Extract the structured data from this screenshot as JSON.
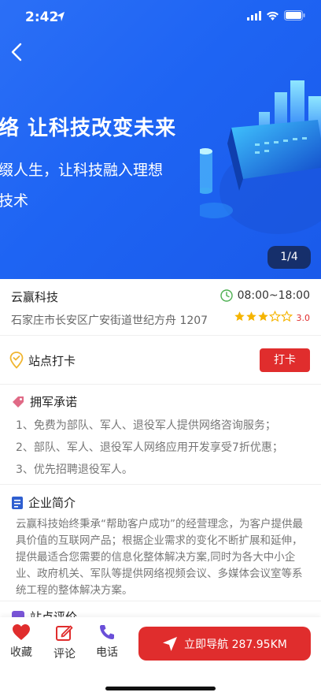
{
  "status_bar": {
    "time": "2:42"
  },
  "hero": {
    "line1": "络  让科技改变未来",
    "line2": "缀人生，让科技融入理想",
    "line3": "技术",
    "page_indicator": "1/4"
  },
  "info": {
    "company_name": "云赢科技",
    "hours": "08:00~18:00",
    "address": "石家庄市长安区广安街道世纪方舟 1207",
    "rating_value": "3.0",
    "rating_stars": 3
  },
  "checkin": {
    "label": "站点打卡",
    "button": "打卡"
  },
  "promise": {
    "title": "拥军承诺",
    "items": [
      "1、免费为部队、军人、退役军人提供网络咨询服务；",
      "2、部队、军人、退役军人网络应用开发享受7折优惠；",
      "3、优先招聘退役军人。"
    ]
  },
  "intro": {
    "title": "企业简介",
    "text": "云赢科技始终秉承“帮助客户成功”的经营理念，为客户提供最具价值的互联网产品；根据企业需求的变化不断扩展和延伸， 提供最适合您需要的信息化整体解决方案,同时为各大中小企业、政府机关、军队等提供网络视频会议、多媒体会议室等系统工程的整体解决方案。"
  },
  "review": {
    "title": "站点评价"
  },
  "bottom_bar": {
    "favorite": "收藏",
    "comment": "评论",
    "phone": "电话",
    "navigate": "立即导航 287.95KM"
  },
  "colors": {
    "hero_blue": "#1e64f3",
    "accent_red": "#e02d2d",
    "star_yellow": "#f5b400"
  }
}
